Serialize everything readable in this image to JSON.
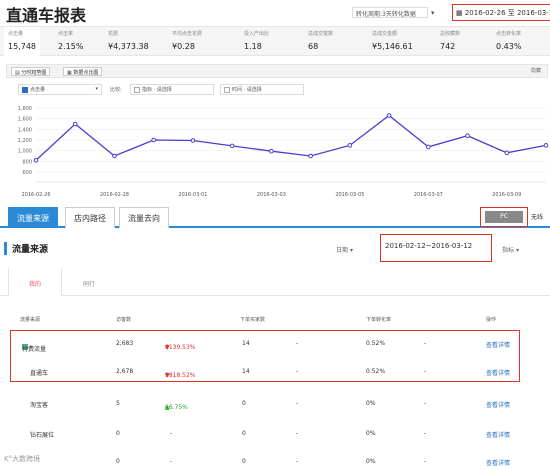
{
  "header": {
    "title": "直通车报表",
    "conversion_period": "转化周期:3天转化数据",
    "date_range": "2016-02-26 至 2016-03-10"
  },
  "metrics": [
    {
      "label": "点击量",
      "value": "15,748"
    },
    {
      "label": "点击率",
      "value": "2.15%"
    },
    {
      "label": "花费",
      "value": "¥4,373.38"
    },
    {
      "label": "平均点击花费",
      "value": "¥0.28"
    },
    {
      "label": "投入产出比",
      "value": "1.18"
    },
    {
      "label": "总成交笔数",
      "value": "68"
    },
    {
      "label": "总成交金额",
      "value": "¥5,146.61"
    },
    {
      "label": "总收藏数",
      "value": "742"
    },
    {
      "label": "点击转化率",
      "value": "0.43%"
    }
  ],
  "toolbar": {
    "btn_trend": "分时趋势图",
    "btn_compare": "数据点比图",
    "right_label": "隐藏",
    "metric_select": "点击量",
    "compare_label": "比较:",
    "compare_select1": "指标 · 请选择",
    "compare_select2": "时间 · 请选择"
  },
  "chart_data": {
    "type": "line",
    "x": [
      "2016-02-26",
      "2016-02-27",
      "2016-02-28",
      "2016-02-29",
      "2016-03-01",
      "2016-03-02",
      "2016-03-03",
      "2016-03-04",
      "2016-03-05",
      "2016-03-06",
      "2016-03-07",
      "2016-03-08",
      "2016-03-09",
      "2016-03-10"
    ],
    "xticks": [
      "2016-02-26",
      "2016-02-28",
      "2016-03-01",
      "2016-03-03",
      "2016-03-05",
      "2016-03-07",
      "2016-03-09"
    ],
    "series": [
      {
        "values": [
          820,
          1500,
          900,
          1200,
          1190,
          1090,
          990,
          900,
          1100,
          1660,
          1070,
          1280,
          960,
          1100
        ]
      }
    ],
    "yticks": [
      "600",
      "800",
      "1,000",
      "1,200",
      "1,400",
      "1,600",
      "1,800"
    ],
    "ylim": [
      600,
      1800
    ],
    "color": "#4a3fcf"
  },
  "tabs": [
    "流量来源",
    "店内路径",
    "流量去向"
  ],
  "device": {
    "pc": "PC",
    "wireless": "无线"
  },
  "source_section": {
    "title": "流量来源",
    "date_label": "日期",
    "date_range": "2016-02-12~2016-03-12",
    "metric_label": "指标"
  },
  "subtabs": [
    "我的",
    "同行"
  ],
  "table": {
    "headers": [
      "流量来源",
      "访客数",
      "下单买家数",
      "下单转化率",
      "操作"
    ],
    "rows": [
      {
        "source": "付费流量",
        "visitors": "2,683",
        "change": "6139.53%",
        "dir": "up",
        "buyers": "14",
        "buyers_change": "-",
        "rate": "0.52%",
        "rate_change": "-",
        "action": "查看详情"
      },
      {
        "source": "直通车",
        "visitors": "2,678",
        "change": "9818.52%",
        "dir": "up",
        "buyers": "14",
        "buyers_change": "-",
        "rate": "0.52%",
        "rate_change": "-",
        "action": "查看详情"
      },
      {
        "source": "淘宝客",
        "visitors": "5",
        "change": "66.75%",
        "dir": "down",
        "buyers": "0",
        "buyers_change": "-",
        "rate": "0%",
        "rate_change": "-",
        "action": "查看详情"
      },
      {
        "source": "钻石展位",
        "visitors": "0",
        "change": "-",
        "dir": "",
        "buyers": "0",
        "buyers_change": "-",
        "rate": "0%",
        "rate_change": "-",
        "action": "查看详情"
      },
      {
        "source": "",
        "visitors": "0",
        "change": "-",
        "dir": "",
        "buyers": "0",
        "buyers_change": "-",
        "rate": "0%",
        "rate_change": "-",
        "action": "查看详情"
      }
    ]
  },
  "watermark": "K°大数跨境"
}
